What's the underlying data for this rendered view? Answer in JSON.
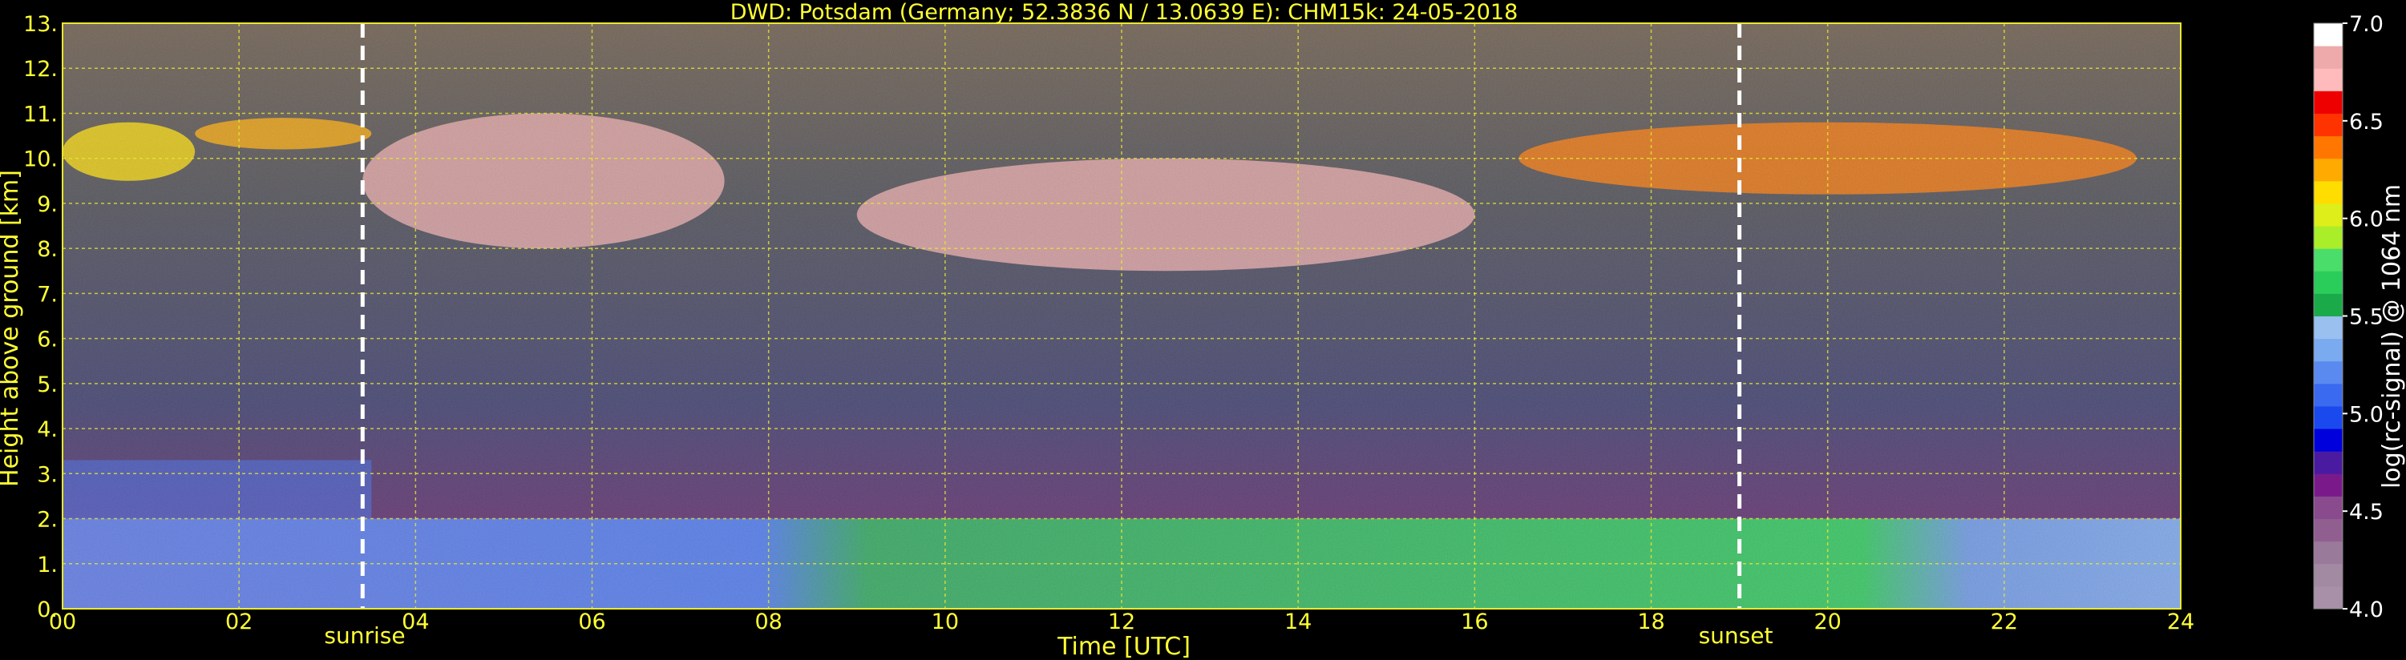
{
  "chart_data": {
    "type": "heatmap",
    "title": "DWD: Potsdam (Germany; 52.3836 N / 13.0639 E):    CHM15k: 24-05-2018",
    "xlabel": "Time [UTC]",
    "ylabel": "Height above ground [km]",
    "xlim": [
      0,
      24
    ],
    "ylim": [
      0,
      13
    ],
    "x_ticks": [
      {
        "value": 0,
        "label": "00"
      },
      {
        "value": 2,
        "label": "02"
      },
      {
        "value": 4,
        "label": "04"
      },
      {
        "value": 6,
        "label": "06"
      },
      {
        "value": 8,
        "label": "08"
      },
      {
        "value": 10,
        "label": "10"
      },
      {
        "value": 12,
        "label": "12"
      },
      {
        "value": 14,
        "label": "14"
      },
      {
        "value": 16,
        "label": "16"
      },
      {
        "value": 18,
        "label": "18"
      },
      {
        "value": 20,
        "label": "20"
      },
      {
        "value": 22,
        "label": "22"
      },
      {
        "value": 24,
        "label": "24"
      }
    ],
    "y_ticks": [
      {
        "value": 0,
        "label": "0."
      },
      {
        "value": 1,
        "label": "1."
      },
      {
        "value": 2,
        "label": "2."
      },
      {
        "value": 3,
        "label": "3."
      },
      {
        "value": 4,
        "label": "4."
      },
      {
        "value": 5,
        "label": "5."
      },
      {
        "value": 6,
        "label": "6."
      },
      {
        "value": 7,
        "label": "7."
      },
      {
        "value": 8,
        "label": "8."
      },
      {
        "value": 9,
        "label": "9."
      },
      {
        "value": 10,
        "label": "10."
      },
      {
        "value": 11,
        "label": "11."
      },
      {
        "value": 12,
        "label": "12."
      },
      {
        "value": 13,
        "label": "13."
      }
    ],
    "grid": true,
    "annotations": [
      {
        "label": "sunrise",
        "x": 3.4
      },
      {
        "label": "sunset",
        "x": 19.0
      }
    ],
    "colorbar": {
      "label": "log(rc-signal) @ 1064 nm",
      "range": [
        4.0,
        7.0
      ],
      "ticks": [
        {
          "value": 4.0,
          "label": "4.0"
        },
        {
          "value": 4.5,
          "label": "4.5"
        },
        {
          "value": 5.0,
          "label": "5.0"
        },
        {
          "value": 5.5,
          "label": "5.5"
        },
        {
          "value": 6.0,
          "label": "6.0"
        },
        {
          "value": 6.5,
          "label": "6.5"
        },
        {
          "value": 7.0,
          "label": "7.0"
        }
      ],
      "colors": [
        "#a891a8",
        "#a28aa2",
        "#9a7a9a",
        "#905f90",
        "#8a4a8e",
        "#7a1a8a",
        "#4a1aa0",
        "#0000dd",
        "#1a4aee",
        "#3a6af0",
        "#5a8af0",
        "#7aaaf0",
        "#9ac0f0",
        "#1aaa4a",
        "#2acc5a",
        "#4add6a",
        "#aaee2a",
        "#ddee1a",
        "#ffdd00",
        "#ffaa00",
        "#ff7700",
        "#ff3300",
        "#ee0000",
        "#ffbbbb",
        "#eeaaaa",
        "#ffffff"
      ]
    },
    "features": [
      {
        "kind": "boundary_layer",
        "x_range": [
          0,
          24
        ],
        "y_range": [
          0,
          2.0
        ],
        "level": 5.2
      },
      {
        "kind": "residual_layer",
        "x_range": [
          0,
          3.5
        ],
        "y_range": [
          2.0,
          3.3
        ],
        "level": 5.1
      },
      {
        "kind": "cirrus",
        "x_range": [
          0,
          1.5
        ],
        "y_range": [
          9.5,
          10.8
        ],
        "level": 6.1
      },
      {
        "kind": "cirrus",
        "x_range": [
          1.5,
          3.5
        ],
        "y_range": [
          10.2,
          10.9
        ],
        "level": 6.3
      },
      {
        "kind": "cirrus",
        "x_range": [
          3.4,
          7.5
        ],
        "y_range": [
          8.0,
          11.0
        ],
        "level": 6.8
      },
      {
        "kind": "cirrus",
        "x_range": [
          9.0,
          16.0
        ],
        "y_range": [
          7.5,
          10.0
        ],
        "level": 6.8
      },
      {
        "kind": "cirrus",
        "x_range": [
          16.5,
          23.5
        ],
        "y_range": [
          9.2,
          10.8
        ],
        "level": 6.4
      }
    ]
  }
}
